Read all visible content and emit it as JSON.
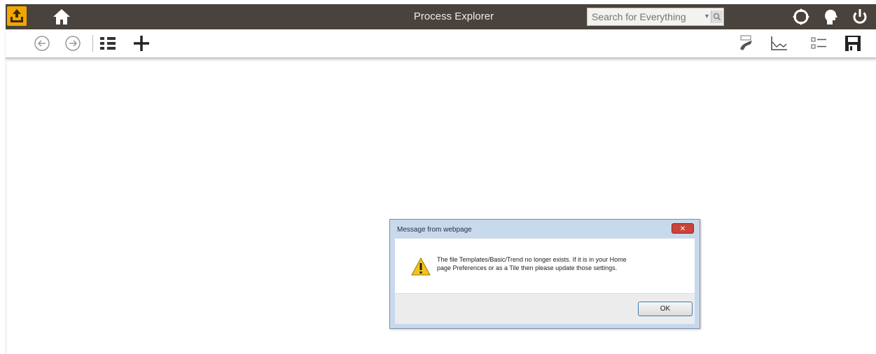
{
  "app": {
    "title": "Process Explorer"
  },
  "topbar": {
    "logo_icon": "upload-tray-icon",
    "home_icon": "home-icon",
    "search_placeholder": "Search for Everything",
    "search_dropdown_glyph": "▼",
    "search_icon": "magnifier-icon",
    "right_icons": [
      "expand-arrows-icon",
      "user-head-icon",
      "power-icon"
    ]
  },
  "toolbar": {
    "left_icons": [
      "back-arrow-icon",
      "forward-arrow-icon",
      "tree-list-icon",
      "plus-icon"
    ],
    "right_icons": [
      "help-hand-icon",
      "trend-chart-icon",
      "checklist-icon",
      "save-disk-icon"
    ]
  },
  "dialog": {
    "title": "Message from webpage",
    "close_label": "✕",
    "message_line1": "The file Templates/Basic/Trend no longer exists. If it is in your Home",
    "message_line2": "page Preferences or as a Tile then please update those settings.",
    "ok_label": "OK",
    "warning_icon": "warning-triangle-icon"
  },
  "colors": {
    "topbar_bg": "#4a423c",
    "logo_bg": "#f2a600",
    "dialog_frame": "#c9d9ec",
    "close_button": "#c9443a",
    "ok_border": "#3c7fb1"
  }
}
